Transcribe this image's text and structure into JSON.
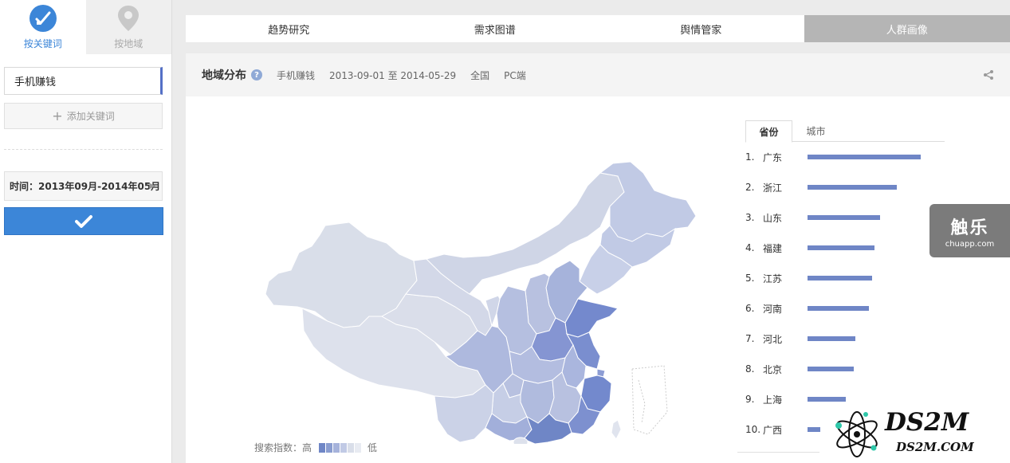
{
  "sidebar": {
    "modes": [
      {
        "label": "按关键词",
        "icon": "keyword-check-icon",
        "active": true
      },
      {
        "label": "按地域",
        "icon": "location-pin-icon",
        "active": false
      }
    ],
    "keyword": "手机赚钱",
    "add_keyword_label": "添加关键词",
    "time_label": "时间：2013年09月-2014年05月",
    "confirm_icon": "checkmark-icon"
  },
  "nav": {
    "tabs": [
      "趋势研究",
      "需求图谱",
      "舆情管家",
      "人群画像"
    ],
    "active_index": 3
  },
  "panel": {
    "title": "地域分布",
    "help": "?",
    "keyword": "手机赚钱",
    "date_range": "2013-09-01 至 2014-05-29",
    "region": "全国",
    "device": "PC端",
    "share_icon": "share-icon"
  },
  "legend": {
    "label_high": "搜索指数：高",
    "label_low": "低",
    "colors": [
      "#6f86c6",
      "#8a9dd0",
      "#a6b3db",
      "#c1cae5",
      "#d9dee9",
      "#e8ebf2"
    ]
  },
  "ranking": {
    "tabs": [
      "省份",
      "城市"
    ],
    "active_tab": 0,
    "items": [
      {
        "rank": "1.",
        "name": "广东",
        "value": 100
      },
      {
        "rank": "2.",
        "name": "浙江",
        "value": 79
      },
      {
        "rank": "3.",
        "name": "山东",
        "value": 64
      },
      {
        "rank": "4.",
        "name": "福建",
        "value": 59
      },
      {
        "rank": "5.",
        "name": "江苏",
        "value": 57
      },
      {
        "rank": "6.",
        "name": "河南",
        "value": 54
      },
      {
        "rank": "7.",
        "name": "河北",
        "value": 42
      },
      {
        "rank": "8.",
        "name": "北京",
        "value": 41
      },
      {
        "rank": "9.",
        "name": "上海",
        "value": 34
      },
      {
        "rank": "10.",
        "name": "广西",
        "value": 11
      }
    ],
    "bar_color": "#6f86c6"
  },
  "watermarks": {
    "chuapp_cn": "触乐",
    "chuapp_en": "chuapp.com",
    "ds2m_big": "DS2M",
    "ds2m_small": "DS2M.COM"
  }
}
